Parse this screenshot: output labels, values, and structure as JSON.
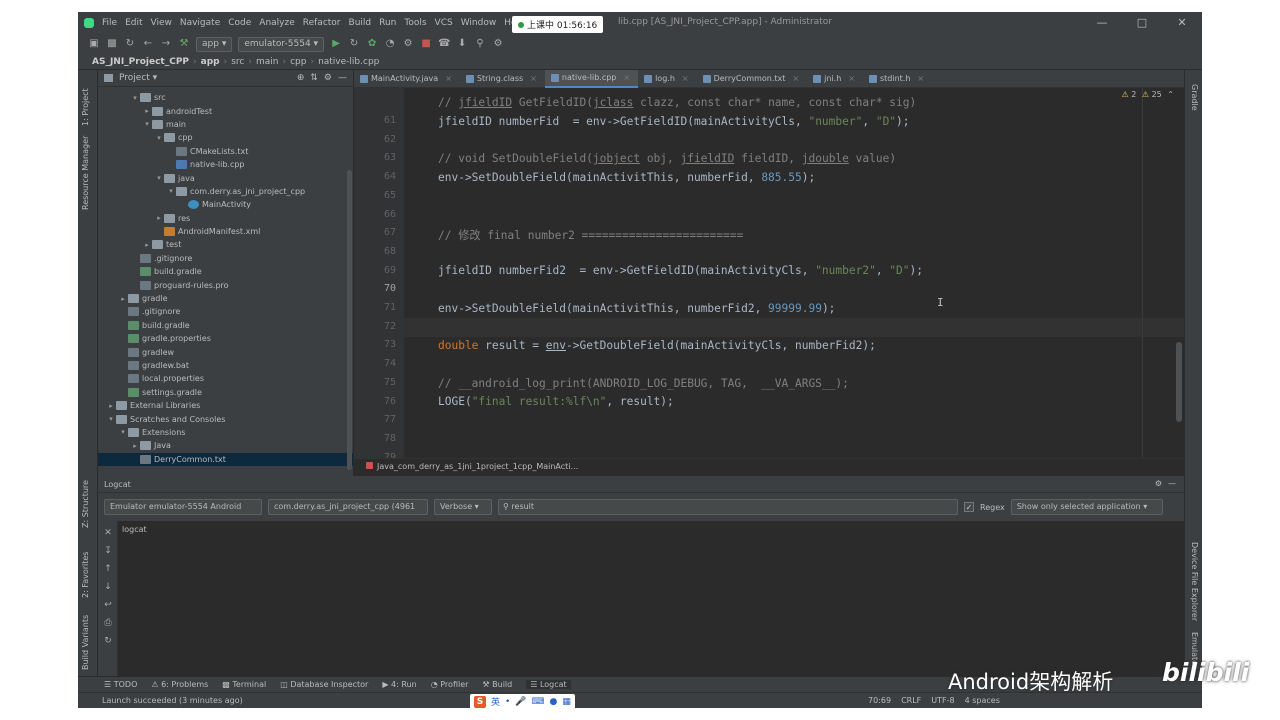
{
  "menubar": {
    "items": [
      "File",
      "Edit",
      "View",
      "Navigate",
      "Code",
      "Analyze",
      "Refactor",
      "Build",
      "Run",
      "Tools",
      "VCS",
      "Window",
      "Help"
    ],
    "title": "lib.cpp [AS_JNI_Project_CPP.app] - Administrator",
    "timer": "上课中 01:56:16"
  },
  "toolbar": {
    "config": "app",
    "device": "emulator-5554"
  },
  "breadcrumb": [
    "AS_JNI_Project_CPP",
    "app",
    "src",
    "main",
    "cpp",
    "native-lib.cpp"
  ],
  "project_panel": {
    "title": "Project",
    "tree": [
      {
        "label": "src",
        "depth": 2,
        "arrow": "▾",
        "type": "folder"
      },
      {
        "label": "androidTest",
        "depth": 3,
        "arrow": "▸",
        "type": "folder"
      },
      {
        "label": "main",
        "depth": 3,
        "arrow": "▾",
        "type": "folder"
      },
      {
        "label": "cpp",
        "depth": 4,
        "arrow": "▾",
        "type": "folder"
      },
      {
        "label": "CMakeLists.txt",
        "depth": 5,
        "arrow": "",
        "type": "file"
      },
      {
        "label": "native-lib.cpp",
        "depth": 5,
        "arrow": "",
        "type": "cpp"
      },
      {
        "label": "java",
        "depth": 4,
        "arrow": "▾",
        "type": "folder"
      },
      {
        "label": "com.derry.as_jni_project_cpp",
        "depth": 5,
        "arrow": "▾",
        "type": "folder"
      },
      {
        "label": "MainActivity",
        "depth": 6,
        "arrow": "",
        "type": "class"
      },
      {
        "label": "res",
        "depth": 4,
        "arrow": "▸",
        "type": "folder"
      },
      {
        "label": "AndroidManifest.xml",
        "depth": 4,
        "arrow": "",
        "type": "xml"
      },
      {
        "label": "test",
        "depth": 3,
        "arrow": "▸",
        "type": "folder"
      },
      {
        "label": ".gitignore",
        "depth": 2,
        "arrow": "",
        "type": "file"
      },
      {
        "label": "build.gradle",
        "depth": 2,
        "arrow": "",
        "type": "gradle"
      },
      {
        "label": "proguard-rules.pro",
        "depth": 2,
        "arrow": "",
        "type": "file"
      },
      {
        "label": "gradle",
        "depth": 1,
        "arrow": "▸",
        "type": "folder"
      },
      {
        "label": ".gitignore",
        "depth": 1,
        "arrow": "",
        "type": "file"
      },
      {
        "label": "build.gradle",
        "depth": 1,
        "arrow": "",
        "type": "gradle"
      },
      {
        "label": "gradle.properties",
        "depth": 1,
        "arrow": "",
        "type": "gradle"
      },
      {
        "label": "gradlew",
        "depth": 1,
        "arrow": "",
        "type": "file"
      },
      {
        "label": "gradlew.bat",
        "depth": 1,
        "arrow": "",
        "type": "file"
      },
      {
        "label": "local.properties",
        "depth": 1,
        "arrow": "",
        "type": "file"
      },
      {
        "label": "settings.gradle",
        "depth": 1,
        "arrow": "",
        "type": "gradle"
      },
      {
        "label": "External Libraries",
        "depth": 0,
        "arrow": "▸",
        "type": "folder"
      },
      {
        "label": "Scratches and Consoles",
        "depth": 0,
        "arrow": "▾",
        "type": "folder"
      },
      {
        "label": "Extensions",
        "depth": 1,
        "arrow": "▾",
        "type": "folder"
      },
      {
        "label": "Java",
        "depth": 2,
        "arrow": "▸",
        "type": "folder"
      },
      {
        "label": "DerryCommon.txt",
        "depth": 2,
        "arrow": "",
        "type": "file",
        "selected": true
      }
    ]
  },
  "side_labels": {
    "left": [
      "1: Project",
      "Resource Manager",
      "Z: Structure",
      "2: Favorites",
      "Build Variants"
    ],
    "right": [
      "Gradle",
      "Device File Explorer",
      "Emulator"
    ]
  },
  "tabs": [
    {
      "label": "MainActivity.java",
      "active": false
    },
    {
      "label": "String.class",
      "active": false
    },
    {
      "label": "native-lib.cpp",
      "active": true
    },
    {
      "label": "log.h",
      "active": false
    },
    {
      "label": "DerryCommon.txt",
      "active": false
    },
    {
      "label": "jni.h",
      "active": false
    },
    {
      "label": "stdint.h",
      "active": false
    }
  ],
  "editor": {
    "warnings": "2",
    "weak_warnings": "25",
    "current_line": 70,
    "lines": [
      {
        "n": 61,
        "segs": [
          [
            "cmt",
            "// "
          ],
          [
            "cmt ul",
            "jfieldID"
          ],
          [
            "cmt",
            " GetFieldID("
          ],
          [
            "cmt ul",
            "jclass"
          ],
          [
            "cmt",
            " clazz, const char* name, const char* sig)"
          ]
        ]
      },
      {
        "n": 62,
        "segs": [
          [
            "",
            "jfieldID numberFid  = env->GetFieldID(mainActivityCls, "
          ],
          [
            "str",
            "\"number\""
          ],
          [
            "",
            ", "
          ],
          [
            "str",
            "\"D\""
          ],
          [
            "",
            ");"
          ]
        ]
      },
      {
        "n": 63,
        "segs": []
      },
      {
        "n": 64,
        "segs": [
          [
            "cmt",
            "// void SetDoubleField("
          ],
          [
            "cmt ul",
            "jobject"
          ],
          [
            "cmt",
            " obj, "
          ],
          [
            "cmt ul",
            "jfieldID"
          ],
          [
            "cmt",
            " fieldID, "
          ],
          [
            "cmt ul",
            "jdouble"
          ],
          [
            "cmt",
            " value)"
          ]
        ]
      },
      {
        "n": 65,
        "segs": [
          [
            "",
            "env->SetDoubleField(mainActivitThis, numberFid, "
          ],
          [
            "num",
            "885.55"
          ],
          [
            "",
            ");"
          ]
        ]
      },
      {
        "n": 66,
        "segs": []
      },
      {
        "n": 67,
        "segs": []
      },
      {
        "n": 68,
        "segs": [
          [
            "cmt",
            "// 修改 final number2 ========================"
          ]
        ]
      },
      {
        "n": 69,
        "segs": []
      },
      {
        "n": 70,
        "segs": [
          [
            "",
            "jfieldID numberFid2  = env->GetFieldID(mainActivityCls, "
          ],
          [
            "str",
            "\"number2\""
          ],
          [
            "",
            ", "
          ],
          [
            "str",
            "\"D\""
          ],
          [
            "",
            ");"
          ]
        ]
      },
      {
        "n": 71,
        "segs": []
      },
      {
        "n": 72,
        "segs": [
          [
            "",
            "env->SetDoubleField(mainActivitThis, numberFid2, "
          ],
          [
            "num",
            "99999.99"
          ],
          [
            "",
            ");"
          ]
        ]
      },
      {
        "n": 73,
        "segs": []
      },
      {
        "n": 74,
        "segs": [
          [
            "kw",
            "double"
          ],
          [
            "",
            " result = "
          ],
          [
            "ul",
            "env"
          ],
          [
            "",
            "->GetDoubleField(mainActivityCls, numberFid2);"
          ]
        ]
      },
      {
        "n": 75,
        "segs": []
      },
      {
        "n": 76,
        "segs": [
          [
            "cmt",
            "// __android_log_print(ANDROID_LOG_DEBUG, TAG,  __VA_ARGS__);"
          ]
        ]
      },
      {
        "n": 77,
        "segs": [
          [
            "",
            "LOGE("
          ],
          [
            "str",
            "\"final result:%lf\\n\""
          ],
          [
            "",
            ", result);"
          ]
        ]
      },
      {
        "n": 78,
        "segs": []
      },
      {
        "n": 79,
        "segs": []
      }
    ],
    "footer_crumb": "Java_com_derry_as_1jni_1project_1cpp_MainActi..."
  },
  "logcat": {
    "title": "Logcat",
    "device": "Emulator emulator-5554 Android",
    "process": "com.derry.as_jni_project_cpp (4961",
    "level": "Verbose",
    "search": "result",
    "regex_label": "Regex",
    "filter": "Show only selected application",
    "body_label": "logcat"
  },
  "bottom_tools": [
    "TODO",
    "6: Problems",
    "Terminal",
    "Database Inspector",
    "4: Run",
    "Profiler",
    "Build",
    "Logcat"
  ],
  "status": {
    "message": "Launch succeeded (3 minutes ago)",
    "position": "70:69",
    "line_sep": "CRLF",
    "encoding": "UTF-8",
    "indent": "4 spaces",
    "ime_label": "英"
  },
  "watermark": {
    "text": "Android架构解析",
    "logo": "bilibili"
  }
}
